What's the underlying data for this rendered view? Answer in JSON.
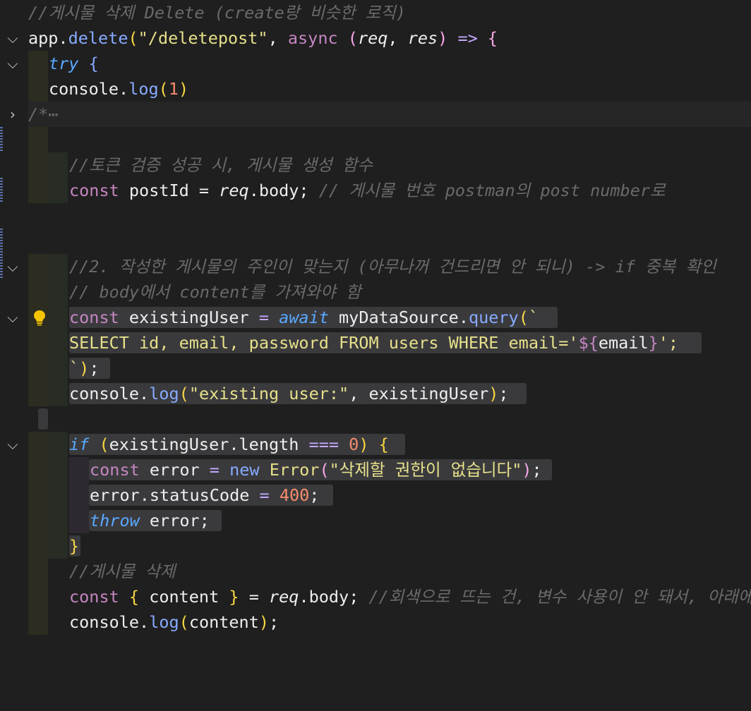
{
  "lines": {
    "l1": "//게시물 삭제 Delete (create랑 비슷한 로직)",
    "l2_app": "app",
    "l2_dot": ".",
    "l2_delete": "delete",
    "l2_open": "(",
    "l2_str": "\"/deletepost\"",
    "l2_comma": ", ",
    "l2_async": "async",
    "l2_sp": " ",
    "l2_p1": "(",
    "l2_req": "req",
    "l2_c": ", ",
    "l2_res": "res",
    "l2_p2": ")",
    "l2_arrow": " => ",
    "l2_brace": "{",
    "l3_try": "try",
    "l3_brace": " {",
    "l4_console": "console",
    "l4_dot": ".",
    "l4_log": "log",
    "l4_p1": "(",
    "l4_num": "1",
    "l4_p2": ")",
    "l5": "/*",
    "l5_ell": "⋯",
    "l7": "//토큰 검증 성공 시, 게시물 생성 함수",
    "l8_const": "const",
    "l8_name": " postId = ",
    "l8_req": "req",
    "l8_body": ".body;",
    "l8_cmt": " // 게시물 번호 postman의 post number로",
    "l10": "//2. 작성한 게시물의 주인이 맞는지 (아무나꺼 건드리면 안 되니) -> if 중복 확인",
    "l11": "// body에서 content를 가져와야 함",
    "l12_const": "const",
    "l12_name": " existingUser ",
    "l12_eq": "=",
    "l12_await": " await",
    "l12_src": " myDataSource",
    "l12_dot": ".",
    "l12_query": "query",
    "l12_p": "(",
    "l12_bt": "`",
    "l13_sql": "SELECT id, email, password FROM users WHERE email='",
    "l13_tpl": "${",
    "l13_email": "email",
    "l13_tplc": "}",
    "l13_end": "';",
    "l14_bt": "`",
    "l14_p": ")",
    "l14_semi": ";",
    "l15_console": "console",
    "l15_dot": ".",
    "l15_log": "log",
    "l15_p1": "(",
    "l15_str": "\"existing user:\"",
    "l15_rest": ", existingUser",
    "l15_p2": ")",
    "l15_semi": ";",
    "l17_if": "if",
    "l17_p1": " (",
    "l17_cond": "existingUser.length ",
    "l17_eq": "===",
    "l17_num": " 0",
    "l17_p2": ")",
    "l17_brace": " {",
    "l18_const": "const",
    "l18_name": " error ",
    "l18_eq": "=",
    "l18_new": " new",
    "l18_err": " Error",
    "l18_p1": "(",
    "l18_str": "\"삭제할 권한이 없습니다\"",
    "l18_p2": ")",
    "l18_semi": ";",
    "l19_name": "error.statusCode ",
    "l19_eq": "=",
    "l19_num": " 400",
    "l19_semi": ";",
    "l20_throw": "throw",
    "l20_rest": " error;",
    "l21_brace": "}",
    "l22": "//게시물 삭제",
    "l23_const": "const",
    "l23_b1": " {",
    "l23_name": " content ",
    "l23_b2": "}",
    "l23_eq": " = ",
    "l23_req": "req",
    "l23_body": ".body;",
    "l23_cmt": " //회색으로 뜨는 건, 변수 사용이 안 돼서, 아래에",
    "l24_console": "console",
    "l24_dot": ".",
    "l24_log": "log",
    "l24_p1": "(",
    "l24_arg": "content",
    "l24_p2": ")",
    "l24_semi": ";"
  },
  "colors": {
    "background": "#1f1f1f",
    "keyword": "#c586c0",
    "function": "#87aaff",
    "string": "#e6e08a",
    "number": "#f78c6c",
    "comment": "#6a6a6a"
  }
}
